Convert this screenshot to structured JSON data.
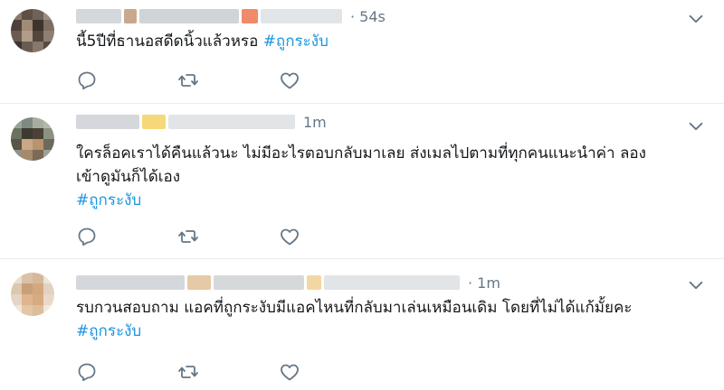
{
  "tweets": [
    {
      "time": "· 54s",
      "text_before": "นี้5ปีที่ธานอสดีดนิ้วแล้วหรอ ",
      "hashtag": "#ถูกระงับ"
    },
    {
      "time": "1m",
      "text_lines": [
        "ใครล็อคเราได้คืนแล้วนะ ไม่มีอะไรตอบกลับมาเลย ส่งเมลไปตามที่ทุกคนแนะนำค่า ลอง",
        "เข้าดูมันก็ได้เอง"
      ],
      "hashtag": "#ถูกระงับ"
    },
    {
      "time": "· 1m",
      "text": "รบกวนสอบถาม แอคที่ถูกระงับมีแอคไหนที่กลับมาเล่นเหมือนเดิม โดยที่ไม่ได้แก้มั้ยคะ",
      "hashtag": "#ถูกระงับ"
    }
  ],
  "colors": {
    "hashtag": "#1b95e0",
    "icon": "#657786",
    "divider": "#e6ecf0"
  },
  "icons": [
    "reply-icon",
    "retweet-icon",
    "like-icon",
    "chevron-down-icon"
  ]
}
